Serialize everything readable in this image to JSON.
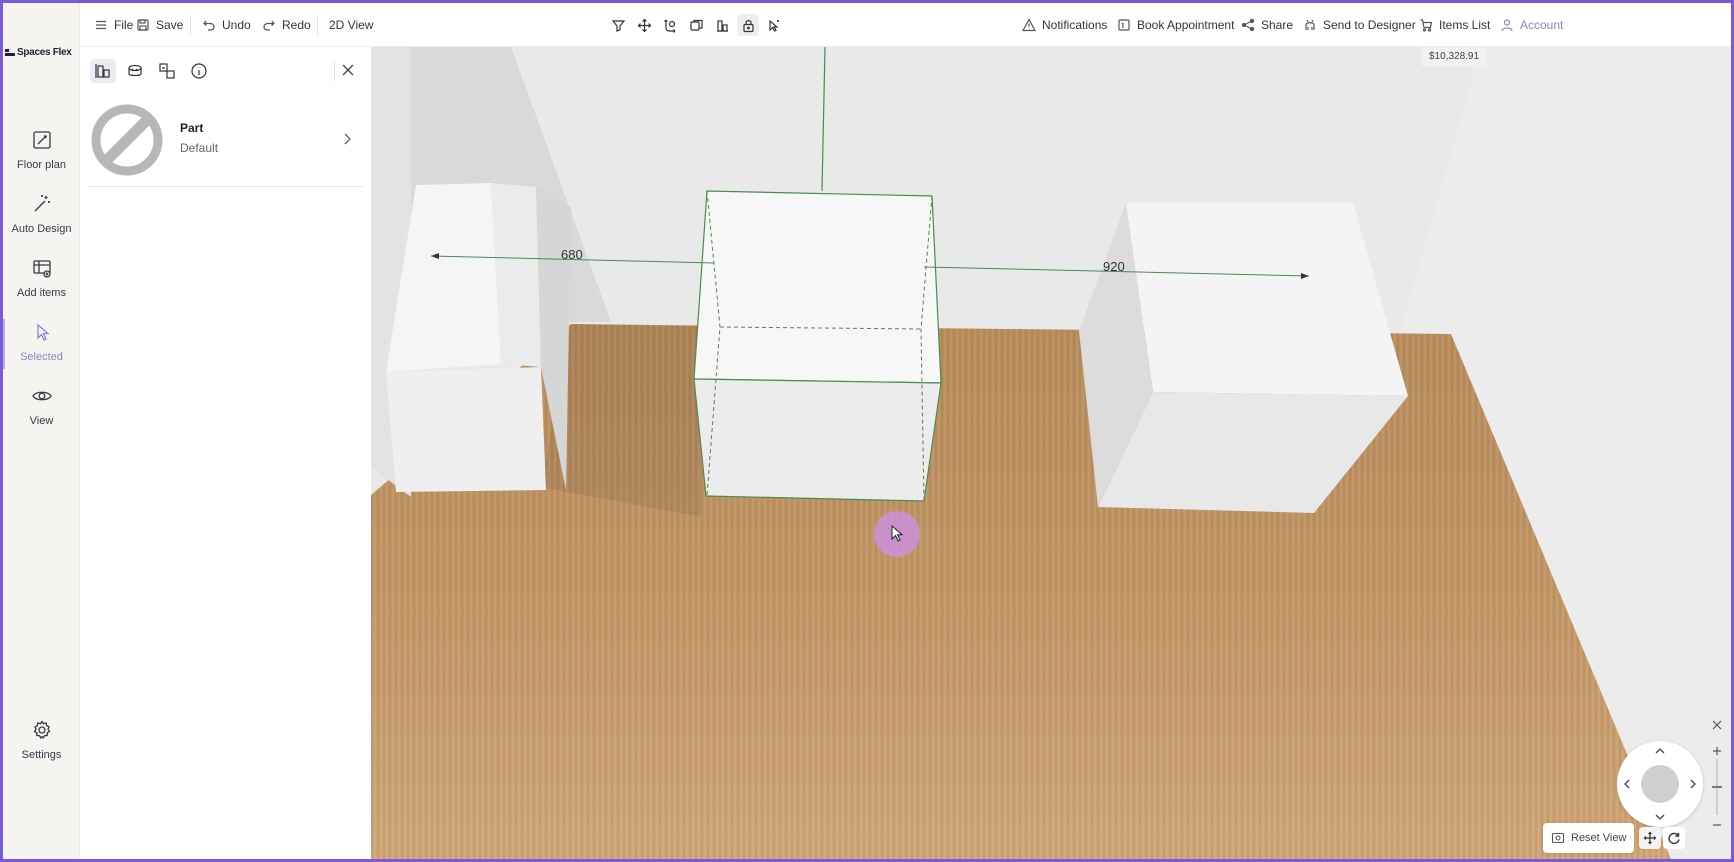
{
  "brand": {
    "name": "Spaces Flex"
  },
  "rail": {
    "items": [
      {
        "label": "Floor plan",
        "icon": "floor-plan-icon"
      },
      {
        "label": "Auto Design",
        "icon": "magic-wand-icon"
      },
      {
        "label": "Add items",
        "icon": "add-items-icon"
      },
      {
        "label": "Selected",
        "icon": "pointer-icon",
        "active": true
      },
      {
        "label": "View",
        "icon": "eye-icon"
      }
    ],
    "settings": {
      "label": "Settings",
      "icon": "gear-icon"
    }
  },
  "topbar": {
    "file": "File",
    "save": "Save",
    "undo": "Undo",
    "redo": "Redo",
    "view2d": "2D View",
    "notifications": "Notifications",
    "book": "Book Appointment",
    "share": "Share",
    "send": "Send to Designer",
    "items_list": "Items List",
    "account": "Account"
  },
  "panel": {
    "part": {
      "name": "Part",
      "value": "Default"
    }
  },
  "viewport": {
    "price": "$10,328.91",
    "dimension_left": "680",
    "dimension_right": "920",
    "reset_view": "Reset View"
  },
  "colors": {
    "accent": "#8f83c9",
    "frame": "#7c5ad6",
    "selection": "#4e8a4e",
    "floor": "#c99a66"
  }
}
